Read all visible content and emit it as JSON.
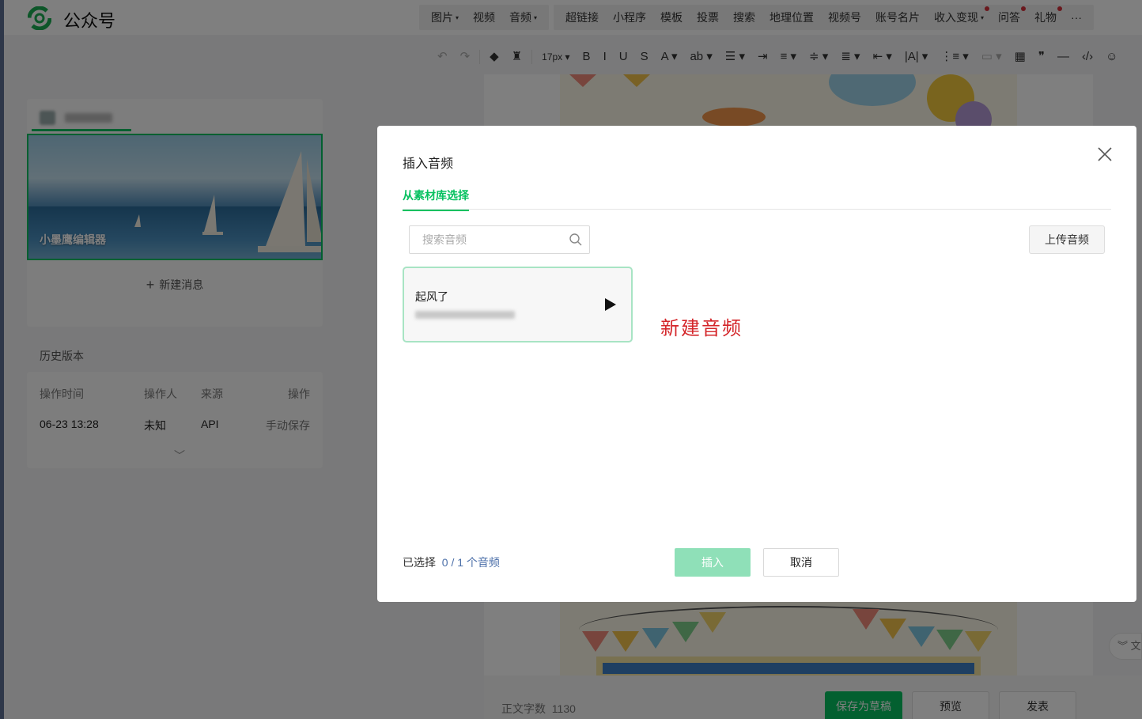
{
  "header": {
    "brand": "公众号",
    "nav": [
      {
        "label": "图片",
        "caret": true,
        "dot": false,
        "group": 1
      },
      {
        "label": "视频",
        "caret": false,
        "dot": false,
        "group": 1
      },
      {
        "label": "音频",
        "caret": true,
        "dot": false,
        "group": 1
      },
      {
        "label": "超链接",
        "caret": false,
        "dot": false,
        "group": 2
      },
      {
        "label": "小程序",
        "caret": false,
        "dot": false,
        "group": 2
      },
      {
        "label": "模板",
        "caret": false,
        "dot": false,
        "group": 2
      },
      {
        "label": "投票",
        "caret": false,
        "dot": false,
        "group": 2
      },
      {
        "label": "搜索",
        "caret": false,
        "dot": false,
        "group": 2
      },
      {
        "label": "地理位置",
        "caret": false,
        "dot": false,
        "group": 2
      },
      {
        "label": "视频号",
        "caret": false,
        "dot": false,
        "group": 2
      },
      {
        "label": "账号名片",
        "caret": false,
        "dot": false,
        "group": 2
      },
      {
        "label": "收入变现",
        "caret": true,
        "dot": true,
        "group": 2
      },
      {
        "label": "问答",
        "caret": false,
        "dot": true,
        "group": 2
      },
      {
        "label": "礼物",
        "caret": false,
        "dot": true,
        "group": 2
      },
      {
        "label": "···",
        "caret": false,
        "dot": false,
        "group": 2
      }
    ],
    "accent_color": "#07c160",
    "dot_color": "#d4303b"
  },
  "toolbar": {
    "font_size": "17px",
    "items": [
      {
        "name": "undo-icon",
        "glyph": "↶",
        "muted": true
      },
      {
        "name": "redo-icon",
        "glyph": "↷",
        "muted": true
      },
      {
        "name": "eraser-icon",
        "glyph": "◆",
        "muted": false
      },
      {
        "name": "format-painter-icon",
        "glyph": "♜",
        "muted": false
      },
      {
        "name": "bold-icon",
        "glyph": "B",
        "muted": false
      },
      {
        "name": "italic-icon",
        "glyph": "I",
        "muted": false
      },
      {
        "name": "underline-icon",
        "glyph": "U",
        "muted": false
      },
      {
        "name": "strikethrough-icon",
        "glyph": "S",
        "muted": false
      },
      {
        "name": "font-color-icon",
        "glyph": "A ▾",
        "muted": false
      },
      {
        "name": "background-color-icon",
        "glyph": "ab ▾",
        "muted": false
      },
      {
        "name": "align-icon",
        "glyph": "☰ ▾",
        "muted": false
      },
      {
        "name": "indent-icon",
        "glyph": "⇥",
        "muted": false
      },
      {
        "name": "align-center-icon",
        "glyph": "≡ ▾",
        "muted": false
      },
      {
        "name": "paragraph-spacing-icon",
        "glyph": "≑ ▾",
        "muted": false
      },
      {
        "name": "line-height-icon",
        "glyph": "≣ ▾",
        "muted": false
      },
      {
        "name": "indent-list-icon",
        "glyph": "⇤ ▾",
        "muted": false
      },
      {
        "name": "letter-spacing-icon",
        "glyph": "|A| ▾",
        "muted": false
      },
      {
        "name": "list-icon",
        "glyph": "⋮≡ ▾",
        "muted": false
      },
      {
        "name": "float-icon",
        "glyph": "▭ ▾",
        "muted": true
      },
      {
        "name": "table-icon",
        "glyph": "▦",
        "muted": false
      },
      {
        "name": "quote-icon",
        "glyph": "❞",
        "muted": false
      },
      {
        "name": "divider-icon",
        "glyph": "—",
        "muted": false
      },
      {
        "name": "code-icon",
        "glyph": "‹/›",
        "muted": false
      },
      {
        "name": "emoji-icon",
        "glyph": "☺",
        "muted": false
      }
    ]
  },
  "left_panel": {
    "cover_title": "小墨鹰编辑器",
    "new_message": "新建消息",
    "history_title": "历史版本",
    "history_headers": {
      "time": "操作时间",
      "operator": "操作人",
      "source": "来源",
      "action": "操作"
    },
    "history_rows": [
      {
        "time": "06-23 13:28",
        "operator": "未知",
        "source": "API",
        "action": "手动保存"
      }
    ]
  },
  "footer": {
    "word_count_label": "正文字数",
    "word_count": "1130",
    "save_draft": "保存为草稿",
    "preview": "预览",
    "publish": "发表",
    "side_float": "文"
  },
  "modal": {
    "title": "插入音频",
    "tab": "从素材库选择",
    "search_placeholder": "搜索音频",
    "upload_button": "上传音频",
    "audio_items": [
      {
        "title": "起风了"
      }
    ],
    "annotation": "新建音频",
    "annotation_color": "#d4262a",
    "selected_prefix": "已选择",
    "selected_count": "0 / 1 个音频",
    "insert_button": "插入",
    "cancel_button": "取消"
  }
}
